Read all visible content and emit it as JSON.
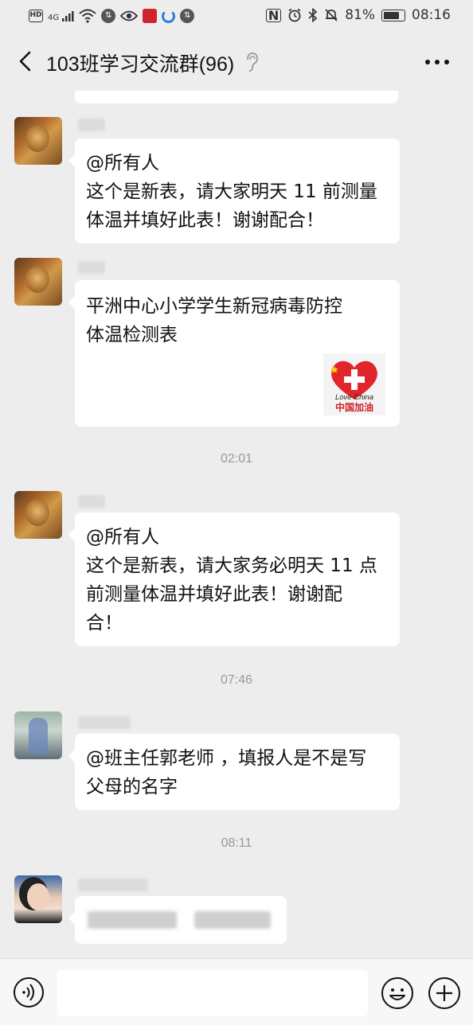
{
  "status_bar": {
    "left_hd": "HD",
    "left_network": "4G",
    "battery_percent": "81%",
    "time": "08:16"
  },
  "header": {
    "title": "103班学习交流群(96)"
  },
  "messages": [
    {
      "type": "text",
      "lines": [
        "@所有人",
        "这个是新表，请大家明天 11 前测量",
        "体温并填好此表！谢谢配合！"
      ]
    },
    {
      "type": "card",
      "lines": [
        "平洲中心小学学生新冠病毒防控",
        "体温检测表"
      ],
      "badge": {
        "line1": "Love China",
        "line2": "中国加油"
      }
    },
    {
      "type": "time",
      "text": "02:01"
    },
    {
      "type": "text",
      "lines": [
        "@所有人",
        "这个是新表，请大家务必明天 11 点",
        "前测量体温并填好此表！谢谢配",
        "合！"
      ]
    },
    {
      "type": "time",
      "text": "07:46"
    },
    {
      "type": "text",
      "lines": [
        "@班主任郭老师 ，填报人是不是写",
        "父母的名字"
      ]
    },
    {
      "type": "time",
      "text": "08:11"
    }
  ],
  "colors": {
    "background": "#ededed",
    "bubble": "#ffffff",
    "timestamp": "#999999",
    "heart_red": "#e0252b"
  },
  "icons": {
    "back": "chevron-left-icon",
    "more": "more-dots-icon",
    "ear": "ear-icon",
    "voice": "voice-icon",
    "emoji": "emoji-icon",
    "plus": "plus-icon"
  }
}
